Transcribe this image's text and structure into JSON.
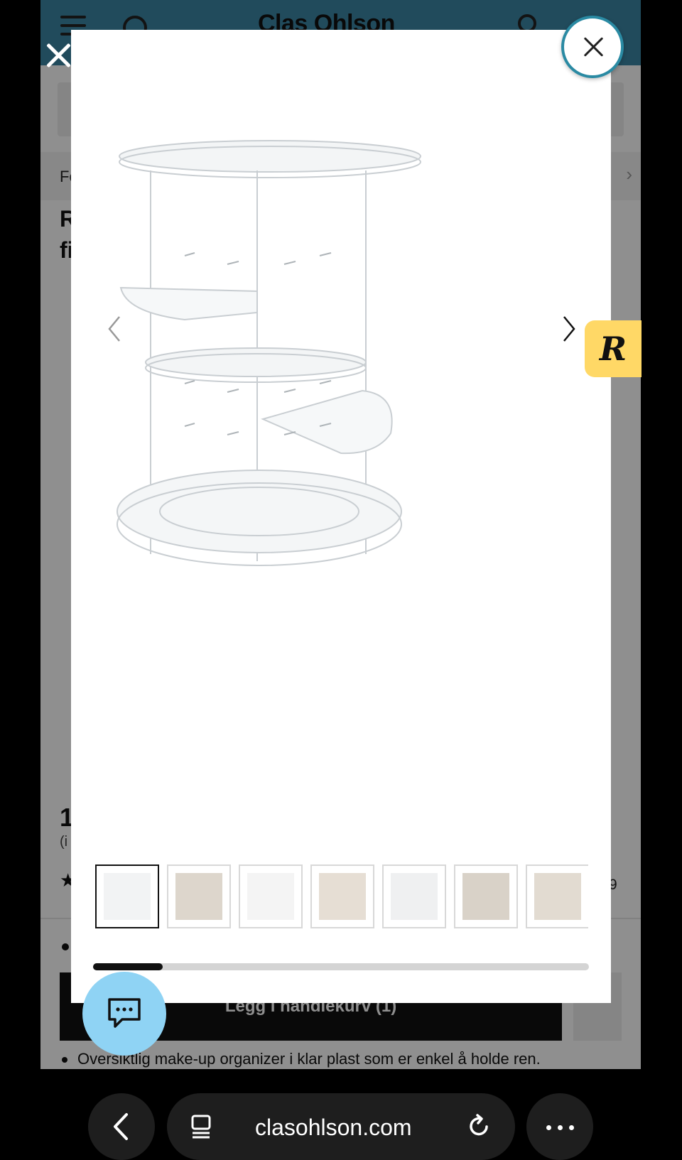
{
  "site": {
    "logo": "Clas Ohlson",
    "breadcrumb": "Fo",
    "title_line1": "R",
    "title_line2": "fi",
    "price": "1",
    "price_note": "(i",
    "review_count": "9",
    "cart_button": "Legg i handlekurv (1)",
    "feature_bullet": "Oversiktlig make-up organizer i klar plast som er enkel å holde ren."
  },
  "lightbox": {
    "thumbnails": [
      {
        "name": "thumb-organizer-front",
        "active": true
      },
      {
        "name": "thumb-organizer-with-cosmetics",
        "active": false
      },
      {
        "name": "thumb-organizer-dimensions",
        "active": false
      },
      {
        "name": "thumb-organizer-on-table",
        "active": false
      },
      {
        "name": "thumb-organizer-side",
        "active": false
      },
      {
        "name": "thumb-organizer-shelf",
        "active": false
      },
      {
        "name": "thumb-organizer-niche",
        "active": false
      }
    ],
    "scroll_progress": 0.14
  },
  "badge": {
    "letter": "R"
  },
  "browser": {
    "url": "clasohlson.com"
  },
  "colors": {
    "header": "#3b86a5",
    "close_ring": "#2a8aa3",
    "chat": "#8fd3f4",
    "badge": "#ffd866"
  }
}
